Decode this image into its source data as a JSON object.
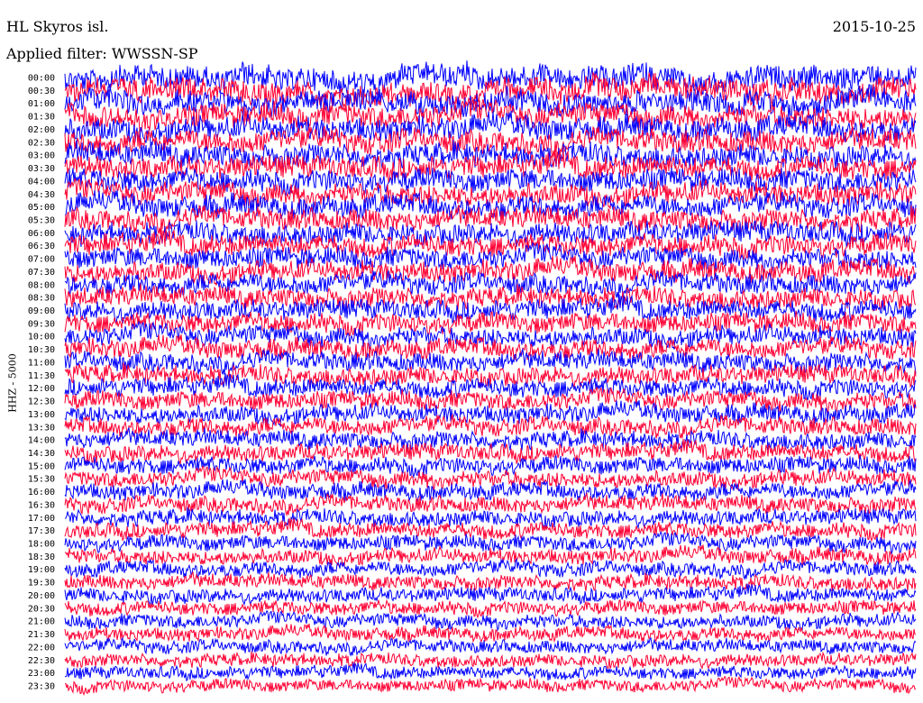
{
  "chart_data": {
    "type": "line",
    "title": "HL Skyros isl.",
    "subtitle": "Applied filter: WWSSN-SP",
    "date": "2015-10-25",
    "ylabel": "HHZ - 5000",
    "row_labels": [
      "00:00",
      "00:30",
      "01:00",
      "01:30",
      "02:00",
      "02:30",
      "03:00",
      "03:30",
      "04:00",
      "04:30",
      "05:00",
      "05:30",
      "06:00",
      "06:30",
      "07:00",
      "07:30",
      "08:00",
      "08:30",
      "09:00",
      "09:30",
      "10:00",
      "10:30",
      "11:00",
      "11:30",
      "12:00",
      "12:30",
      "13:00",
      "13:30",
      "14:00",
      "14:30",
      "15:00",
      "15:30",
      "16:00",
      "16:30",
      "17:00",
      "17:30",
      "18:00",
      "18:30",
      "19:00",
      "19:30",
      "20:00",
      "20:30",
      "21:00",
      "21:30",
      "22:00",
      "22:30",
      "23:00",
      "23:30"
    ],
    "series_colors": [
      "#0000ff",
      "#ff0033"
    ],
    "grid": false
  }
}
